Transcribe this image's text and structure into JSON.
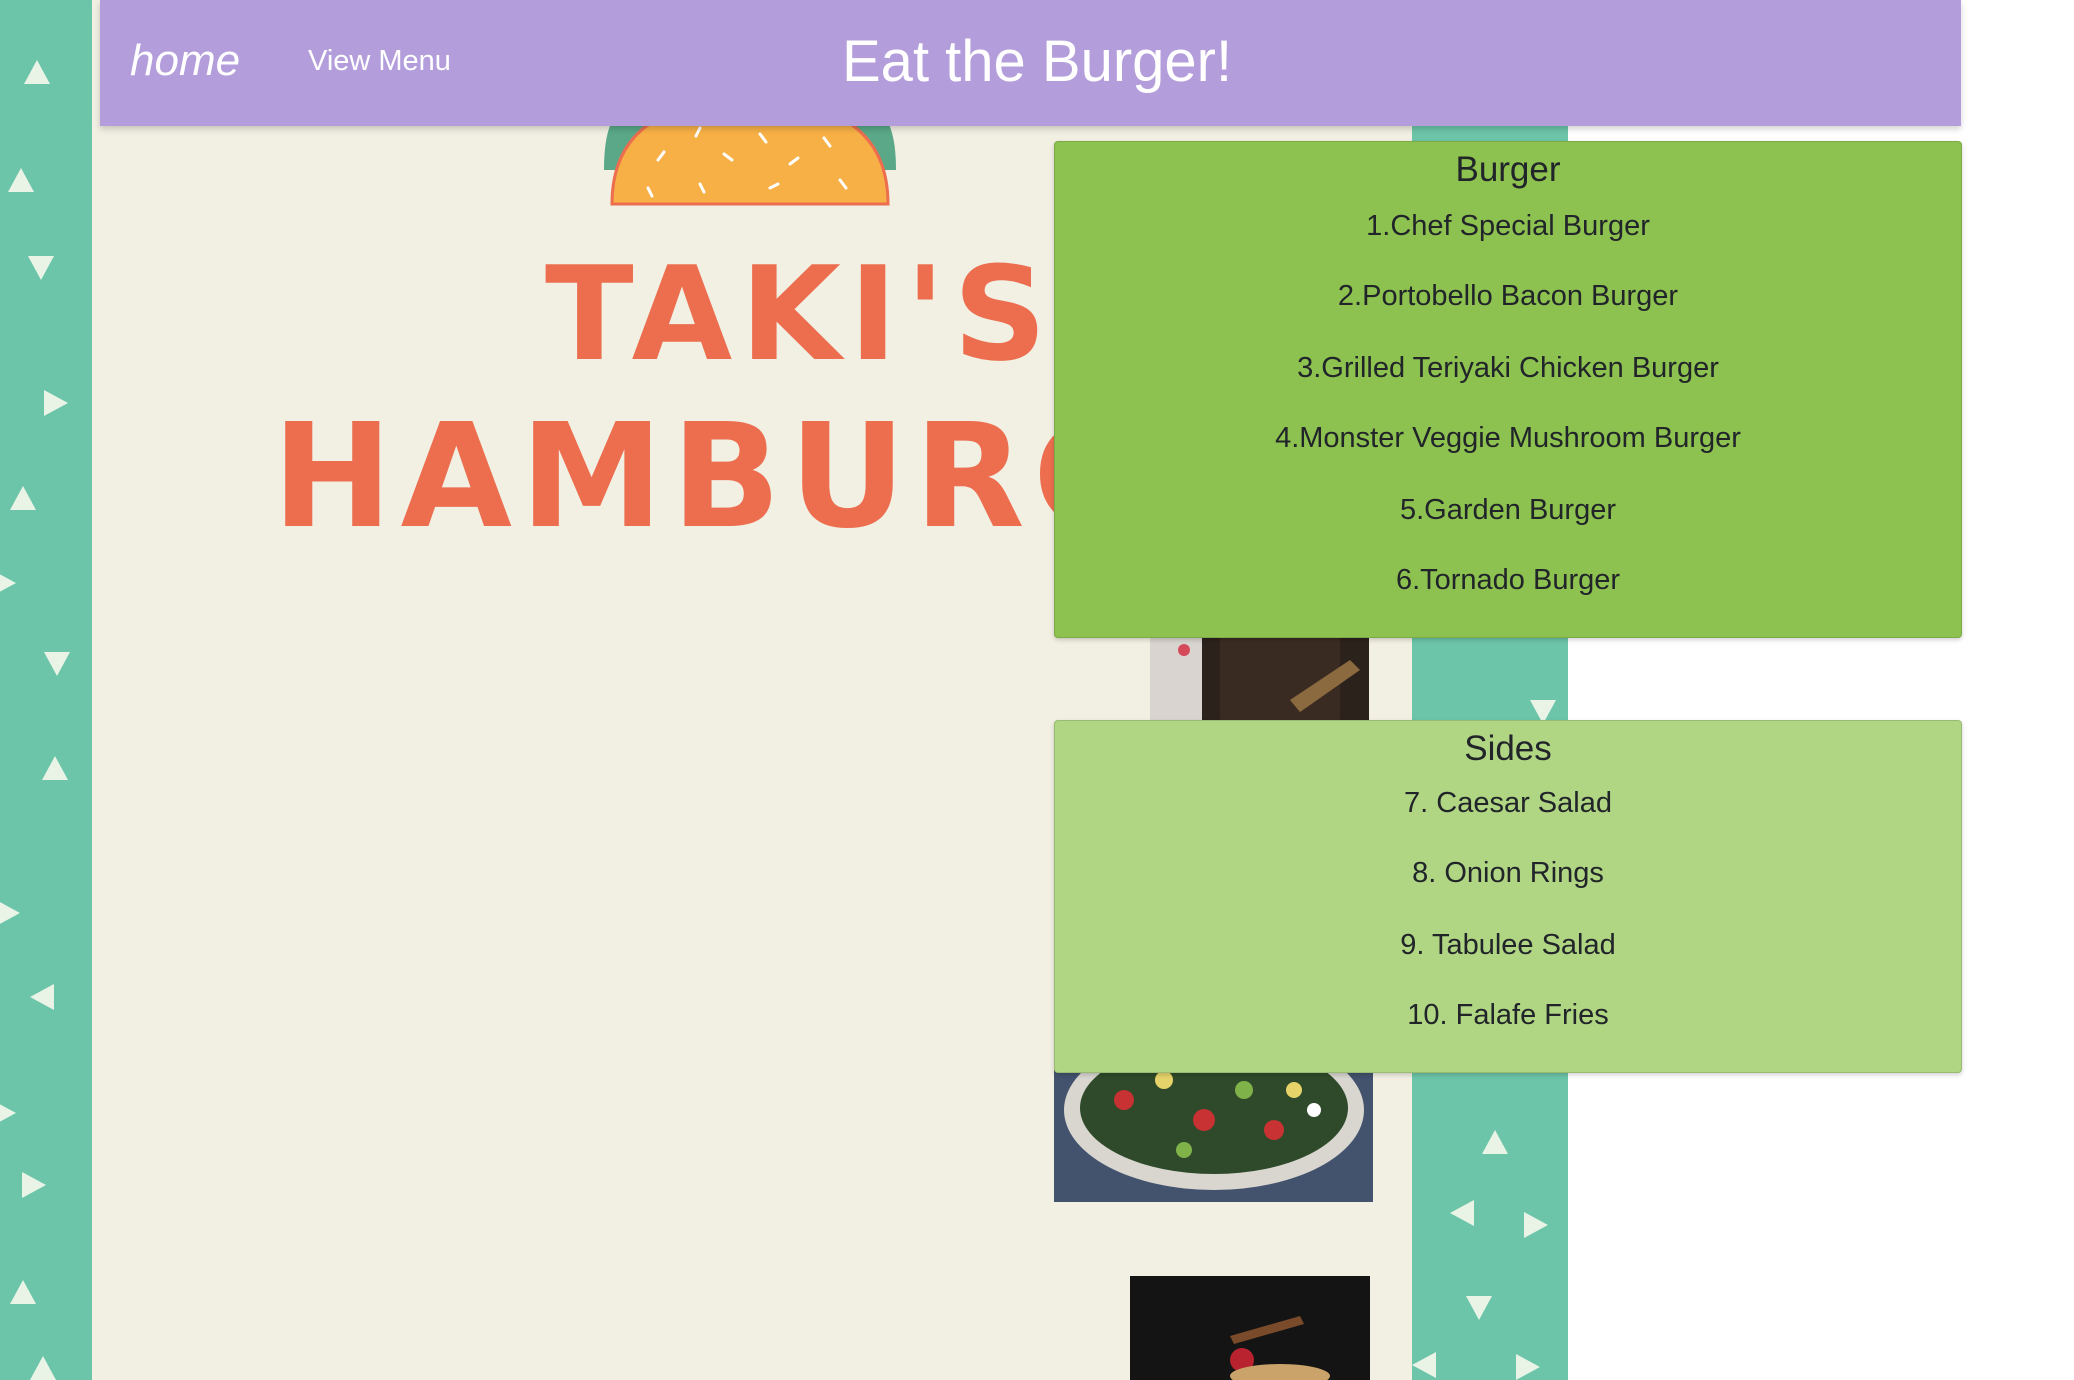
{
  "navbar": {
    "home_label": "home",
    "view_menu_label": "View Menu",
    "title": "Eat the Burger!",
    "background_color": "#b39edb"
  },
  "logo": {
    "line1": "TAKI'S",
    "line2": "HAMBURG",
    "color": "#ec6e4f",
    "icon": "taco-icon"
  },
  "menu": {
    "burger": {
      "title": "Burger",
      "background_color": "#8dc250",
      "items": [
        "1.Chef Special Burger",
        "2.Portobello Bacon Burger",
        "3.Grilled Teriyaki Chicken Burger",
        "4.Monster Veggie Mushroom Burger",
        "5.Garden Burger",
        "6.Tornado Burger"
      ]
    },
    "sides": {
      "title": "Sides",
      "background_color": "#b0d583",
      "items": [
        "7. Caesar Salad",
        "8. Onion Rings",
        "9. Tabulee Salad",
        "10. Falafe Fries"
      ]
    }
  },
  "background": {
    "pattern_color": "#6cc5a9",
    "panel_color": "#f2efe3"
  }
}
